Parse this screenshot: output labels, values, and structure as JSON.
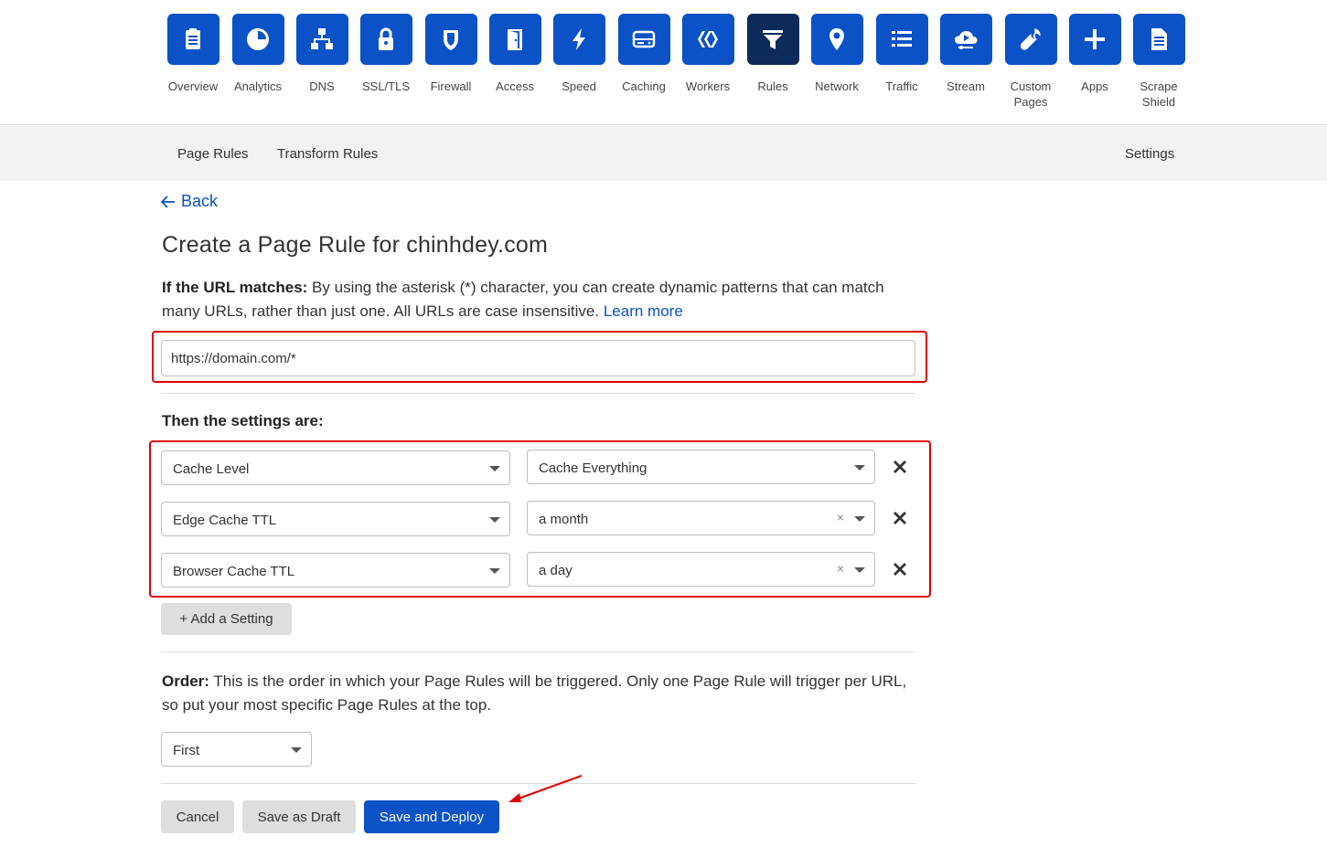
{
  "nav": [
    {
      "label": "Overview",
      "icon": "clipboard-icon"
    },
    {
      "label": "Analytics",
      "icon": "pie-chart-icon"
    },
    {
      "label": "DNS",
      "icon": "network-tree-icon"
    },
    {
      "label": "SSL/TLS",
      "icon": "lock-icon"
    },
    {
      "label": "Firewall",
      "icon": "shield-icon"
    },
    {
      "label": "Access",
      "icon": "door-icon"
    },
    {
      "label": "Speed",
      "icon": "lightning-icon"
    },
    {
      "label": "Caching",
      "icon": "server-drive-icon"
    },
    {
      "label": "Workers",
      "icon": "workers-icon"
    },
    {
      "label": "Rules",
      "icon": "filter-icon",
      "active": true
    },
    {
      "label": "Network",
      "icon": "location-pin-icon"
    },
    {
      "label": "Traffic",
      "icon": "list-icon"
    },
    {
      "label": "Stream",
      "icon": "cloud-play-icon"
    },
    {
      "label": "Custom\nPages",
      "icon": "wrench-icon"
    },
    {
      "label": "Apps",
      "icon": "plus-icon"
    },
    {
      "label": "Scrape\nShield",
      "icon": "document-icon"
    }
  ],
  "subnav": {
    "page_rules": "Page Rules",
    "transform_rules": "Transform Rules",
    "settings": "Settings"
  },
  "back_label": "Back",
  "title": "Create a Page Rule for chinhdey.com",
  "url_section": {
    "label": "If the URL matches:",
    "text": " By using the asterisk (*) character, you can create dynamic patterns that can match many URLs, rather than just one. All URLs are case insensitive. ",
    "link": "Learn more",
    "input_value": "https://domain.com/*"
  },
  "settings_label": "Then the settings are:",
  "settings": [
    {
      "setting": "Cache Level",
      "value": "Cache Everything",
      "clearable": false
    },
    {
      "setting": "Edge Cache TTL",
      "value": "a month",
      "clearable": true
    },
    {
      "setting": "Browser Cache TTL",
      "value": "a day",
      "clearable": true
    }
  ],
  "add_setting_label": "+ Add a Setting",
  "order_section": {
    "label": "Order:",
    "text": " This is the order in which your Page Rules will be triggered. Only one Page Rule will trigger per URL, so put your most specific Page Rules at the top.",
    "value": "First"
  },
  "buttons": {
    "cancel": "Cancel",
    "draft": "Save as Draft",
    "deploy": "Save and Deploy"
  },
  "colors": {
    "brand_blue": "#0a52c6",
    "active_tile": "#0c2a5a",
    "highlight_red": "#e00000"
  }
}
